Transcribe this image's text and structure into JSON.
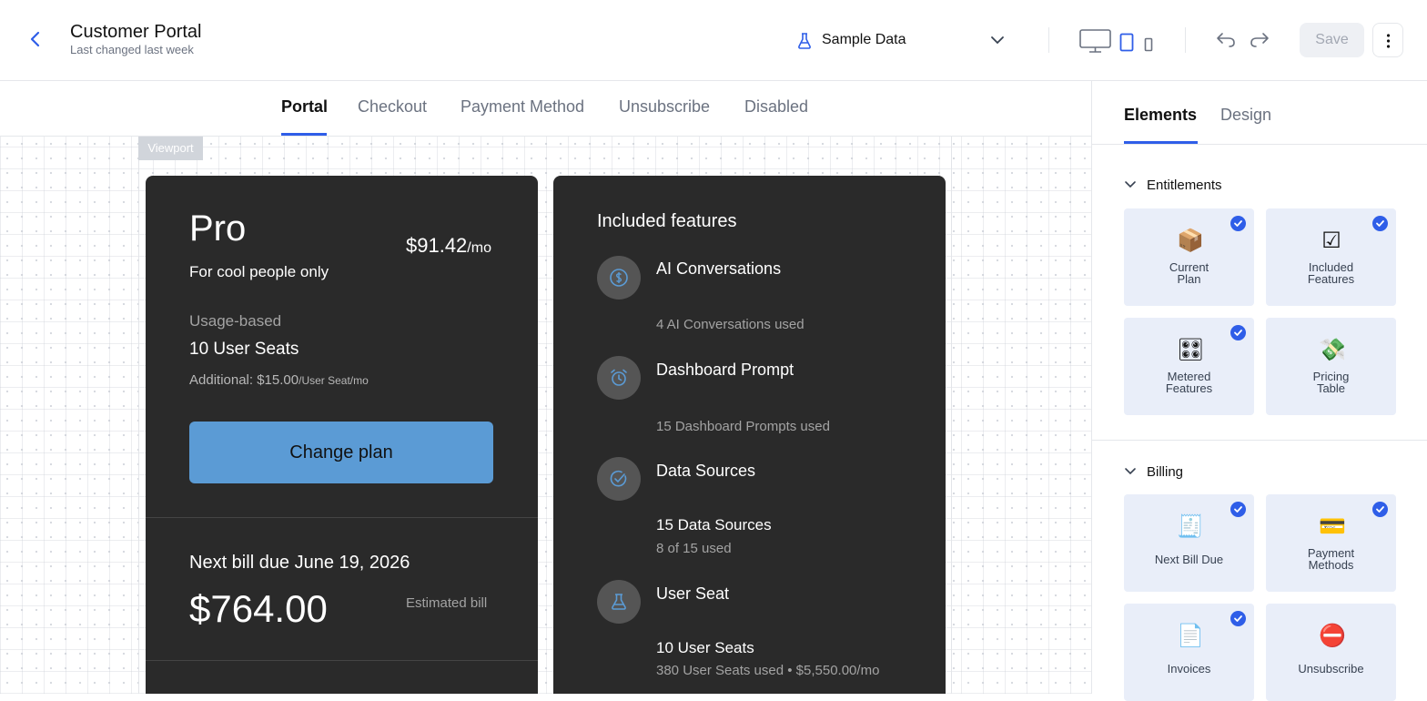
{
  "header": {
    "title": "Customer Portal",
    "subtitle": "Last changed last week",
    "sample_data": "Sample Data",
    "save_label": "Save"
  },
  "tabs": [
    "Portal",
    "Checkout",
    "Payment Method",
    "Unsubscribe",
    "Disabled"
  ],
  "canvas": {
    "viewport_label": "Viewport"
  },
  "plan_card": {
    "name": "Pro",
    "price": "$91.42",
    "price_unit": "/mo",
    "tagline": "For cool people only",
    "usage_type": "Usage-based",
    "seats": "10 User Seats",
    "additional": "Additional: $15.00",
    "additional_unit": "/User Seat/mo",
    "button": "Change plan",
    "next_bill": "Next bill due June 19, 2026",
    "amount": "$764.00",
    "estimated": "Estimated bill"
  },
  "features_card": {
    "title": "Included features",
    "items": [
      {
        "name": "AI Conversations",
        "icon": "dollar-icon",
        "value": "",
        "usage": "4 AI Conversations used"
      },
      {
        "name": "Dashboard Prompt",
        "icon": "alarm-icon",
        "value": "",
        "usage": "15 Dashboard Prompts used"
      },
      {
        "name": "Data Sources",
        "icon": "check-circle-icon",
        "value": "15 Data Sources",
        "usage": "8 of 15 used"
      },
      {
        "name": "User Seat",
        "icon": "flask-icon",
        "value": "10 User Seats",
        "usage": "380 User Seats used • $5,550.00/mo"
      }
    ]
  },
  "panel": {
    "tabs": [
      "Elements",
      "Design"
    ],
    "entitlements": {
      "title": "Entitlements",
      "tiles": [
        {
          "label": "Current Plan",
          "icon": "package-icon",
          "checked": true
        },
        {
          "label": "Included Features",
          "icon": "checkbox-icon",
          "checked": true
        },
        {
          "label": "Metered Features",
          "icon": "dial-icon",
          "checked": true
        },
        {
          "label": "Pricing Table",
          "icon": "money-icon",
          "checked": false
        }
      ]
    },
    "billing": {
      "title": "Billing",
      "tiles": [
        {
          "label": "Next Bill Due",
          "icon": "receipt-icon",
          "checked": true
        },
        {
          "label": "Payment Methods",
          "icon": "credit-card-icon",
          "checked": true
        },
        {
          "label": "Invoices",
          "icon": "document-icon",
          "checked": true
        },
        {
          "label": "Unsubscribe",
          "icon": "no-entry-icon",
          "checked": false
        }
      ]
    }
  },
  "colors": {
    "accent": "#2f5ee8",
    "card": "#2a2a2a",
    "button": "#5b9bd5"
  }
}
